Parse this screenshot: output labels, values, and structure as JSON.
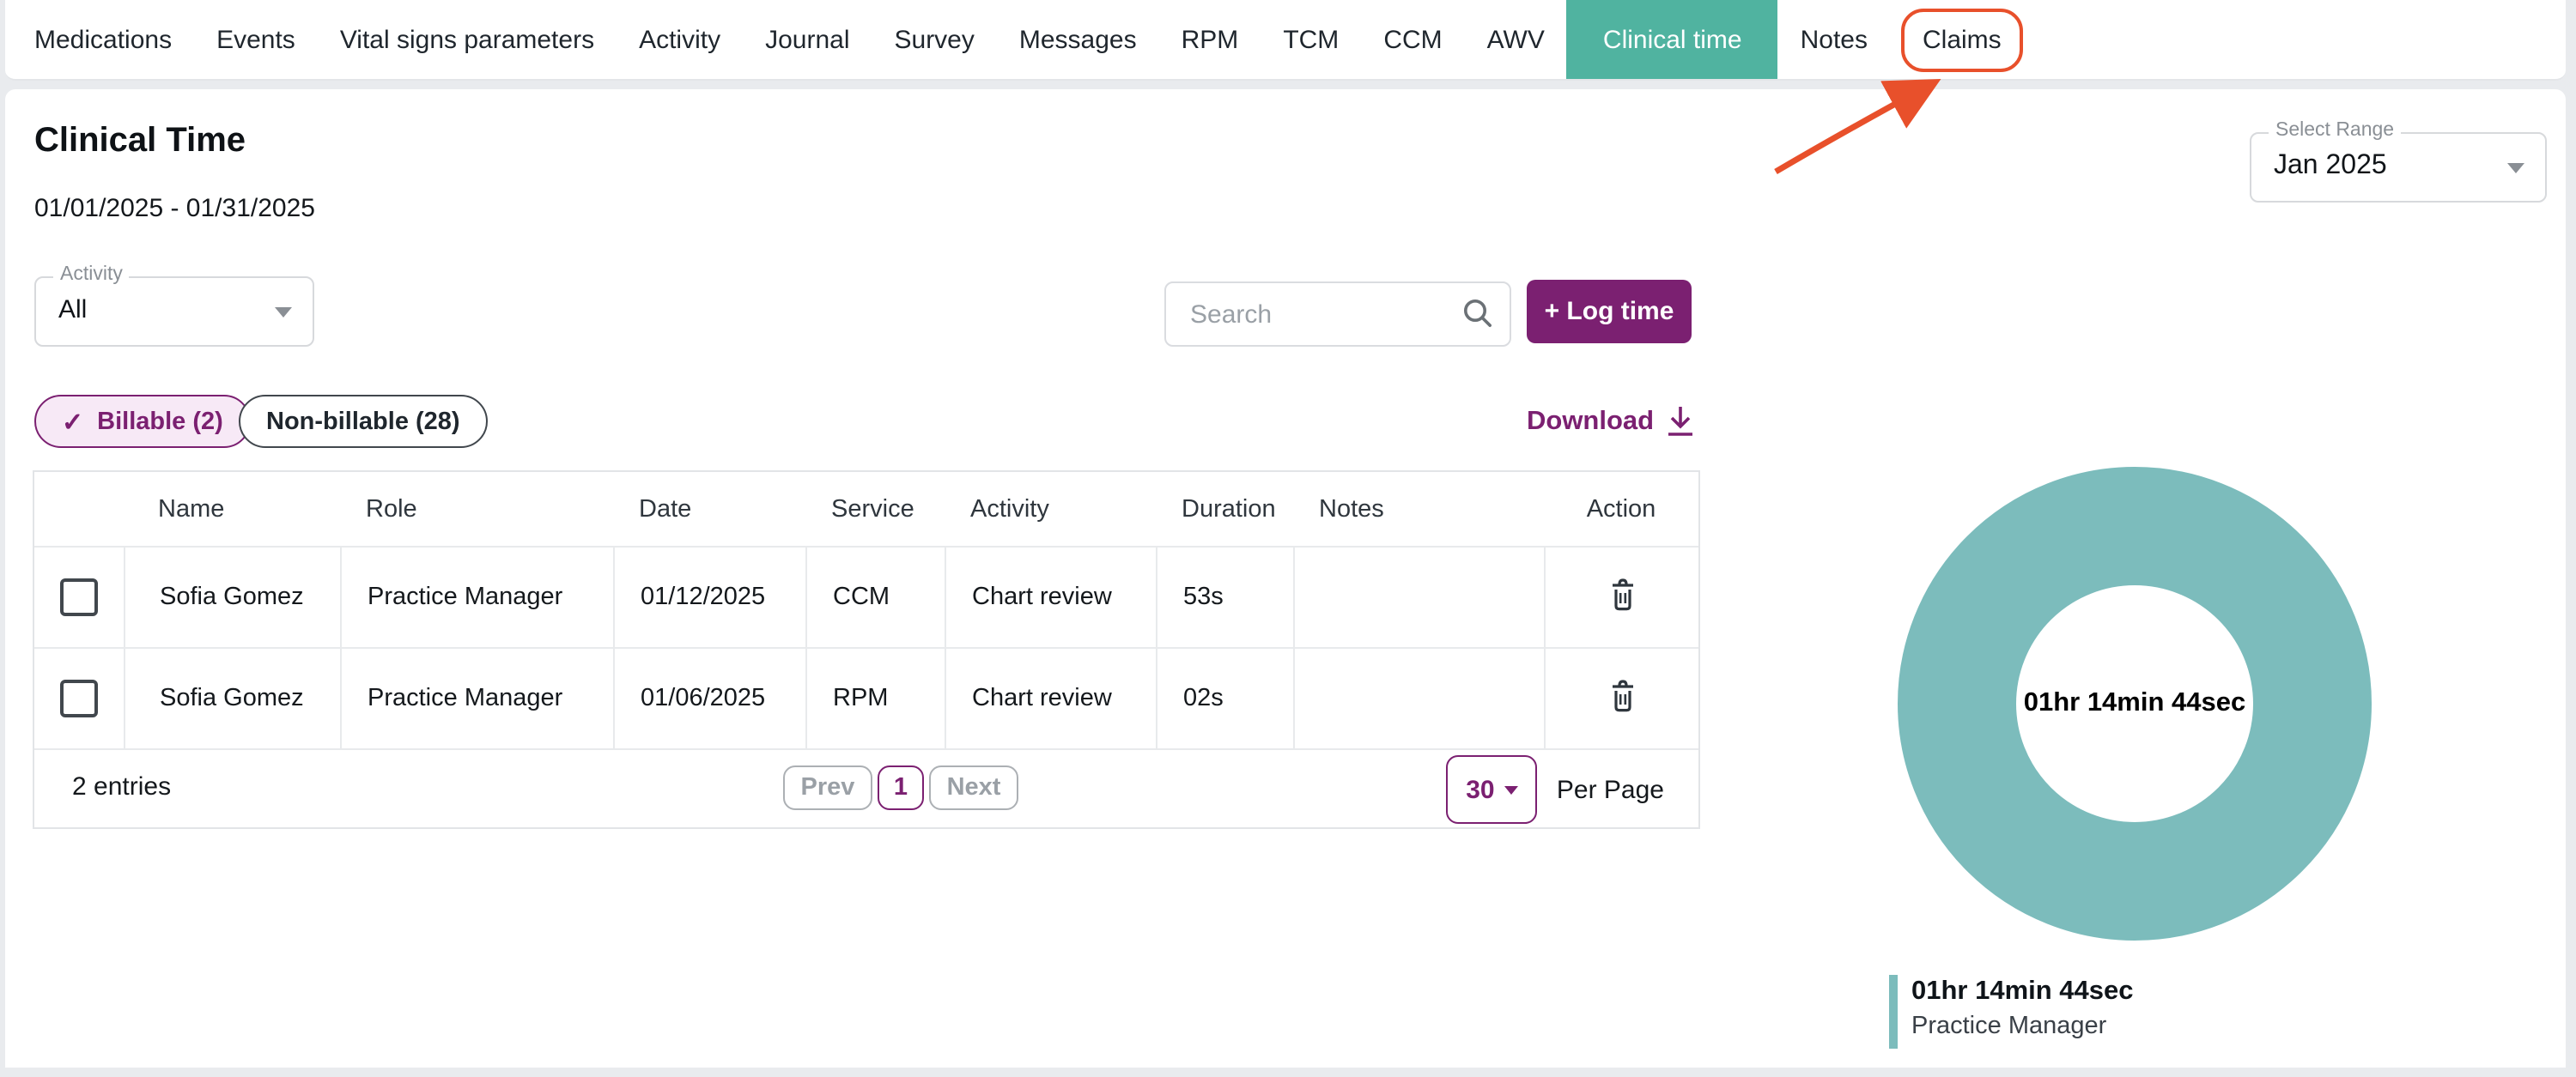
{
  "nav": {
    "items": [
      {
        "label": "Medications"
      },
      {
        "label": "Events"
      },
      {
        "label": "Vital signs parameters"
      },
      {
        "label": "Activity"
      },
      {
        "label": "Journal"
      },
      {
        "label": "Survey"
      },
      {
        "label": "Messages"
      },
      {
        "label": "RPM"
      },
      {
        "label": "TCM"
      },
      {
        "label": "CCM"
      },
      {
        "label": "AWV"
      },
      {
        "label": "Clinical time",
        "state": "active"
      },
      {
        "label": "Notes"
      },
      {
        "label": "Claims",
        "state": "annotated-with-red-ring"
      }
    ]
  },
  "page": {
    "title": "Clinical Time",
    "date_range": "01/01/2025 - 01/31/2025"
  },
  "range_select": {
    "label": "Select Range",
    "value": "Jan 2025"
  },
  "activity_select": {
    "label": "Activity",
    "value": "All"
  },
  "search": {
    "placeholder": "Search"
  },
  "buttons": {
    "log_time": "+ Log time",
    "download": "Download"
  },
  "filters": {
    "billable": {
      "label": "Billable (2)",
      "selected": true,
      "check_glyph": "✓"
    },
    "non_billable": {
      "label": "Non-billable (28)",
      "selected": false
    }
  },
  "table": {
    "headers": [
      "Name",
      "Role",
      "Date",
      "Service",
      "Activity",
      "Duration",
      "Notes",
      "Action"
    ],
    "rows": [
      {
        "name": "Sofia Gomez",
        "role": "Practice Manager",
        "date": "01/12/2025",
        "service": "CCM",
        "activity": "Chart review",
        "duration": "53s",
        "notes": ""
      },
      {
        "name": "Sofia Gomez",
        "role": "Practice Manager",
        "date": "01/06/2025",
        "service": "RPM",
        "activity": "Chart review",
        "duration": "02s",
        "notes": ""
      }
    ],
    "pagination": {
      "entries": "2 entries",
      "prev": "Prev",
      "page": "1",
      "next": "Next",
      "per_page_value": "30",
      "per_page_label": "Per Page"
    }
  },
  "chart_data": {
    "type": "pie",
    "donut": true,
    "center_label": "01hr 14min 44sec",
    "series": [
      {
        "name": "Practice Manager",
        "value_label": "01hr 14min 44sec",
        "value_seconds": 4484,
        "fraction": 1.0,
        "color": "#7CBCBC"
      }
    ],
    "legend_position": "bottom-left"
  },
  "legend": {
    "value": "01hr 14min 44sec",
    "name": "Practice Manager"
  },
  "colors": {
    "active_tab_teal": "#50B3A0",
    "donut_teal": "#7CBCBC",
    "purple": "#7B2071",
    "chip_bg": "#F7E9F6",
    "annotation_red": "#E8502B",
    "page_bg": "#E9EBEE"
  }
}
